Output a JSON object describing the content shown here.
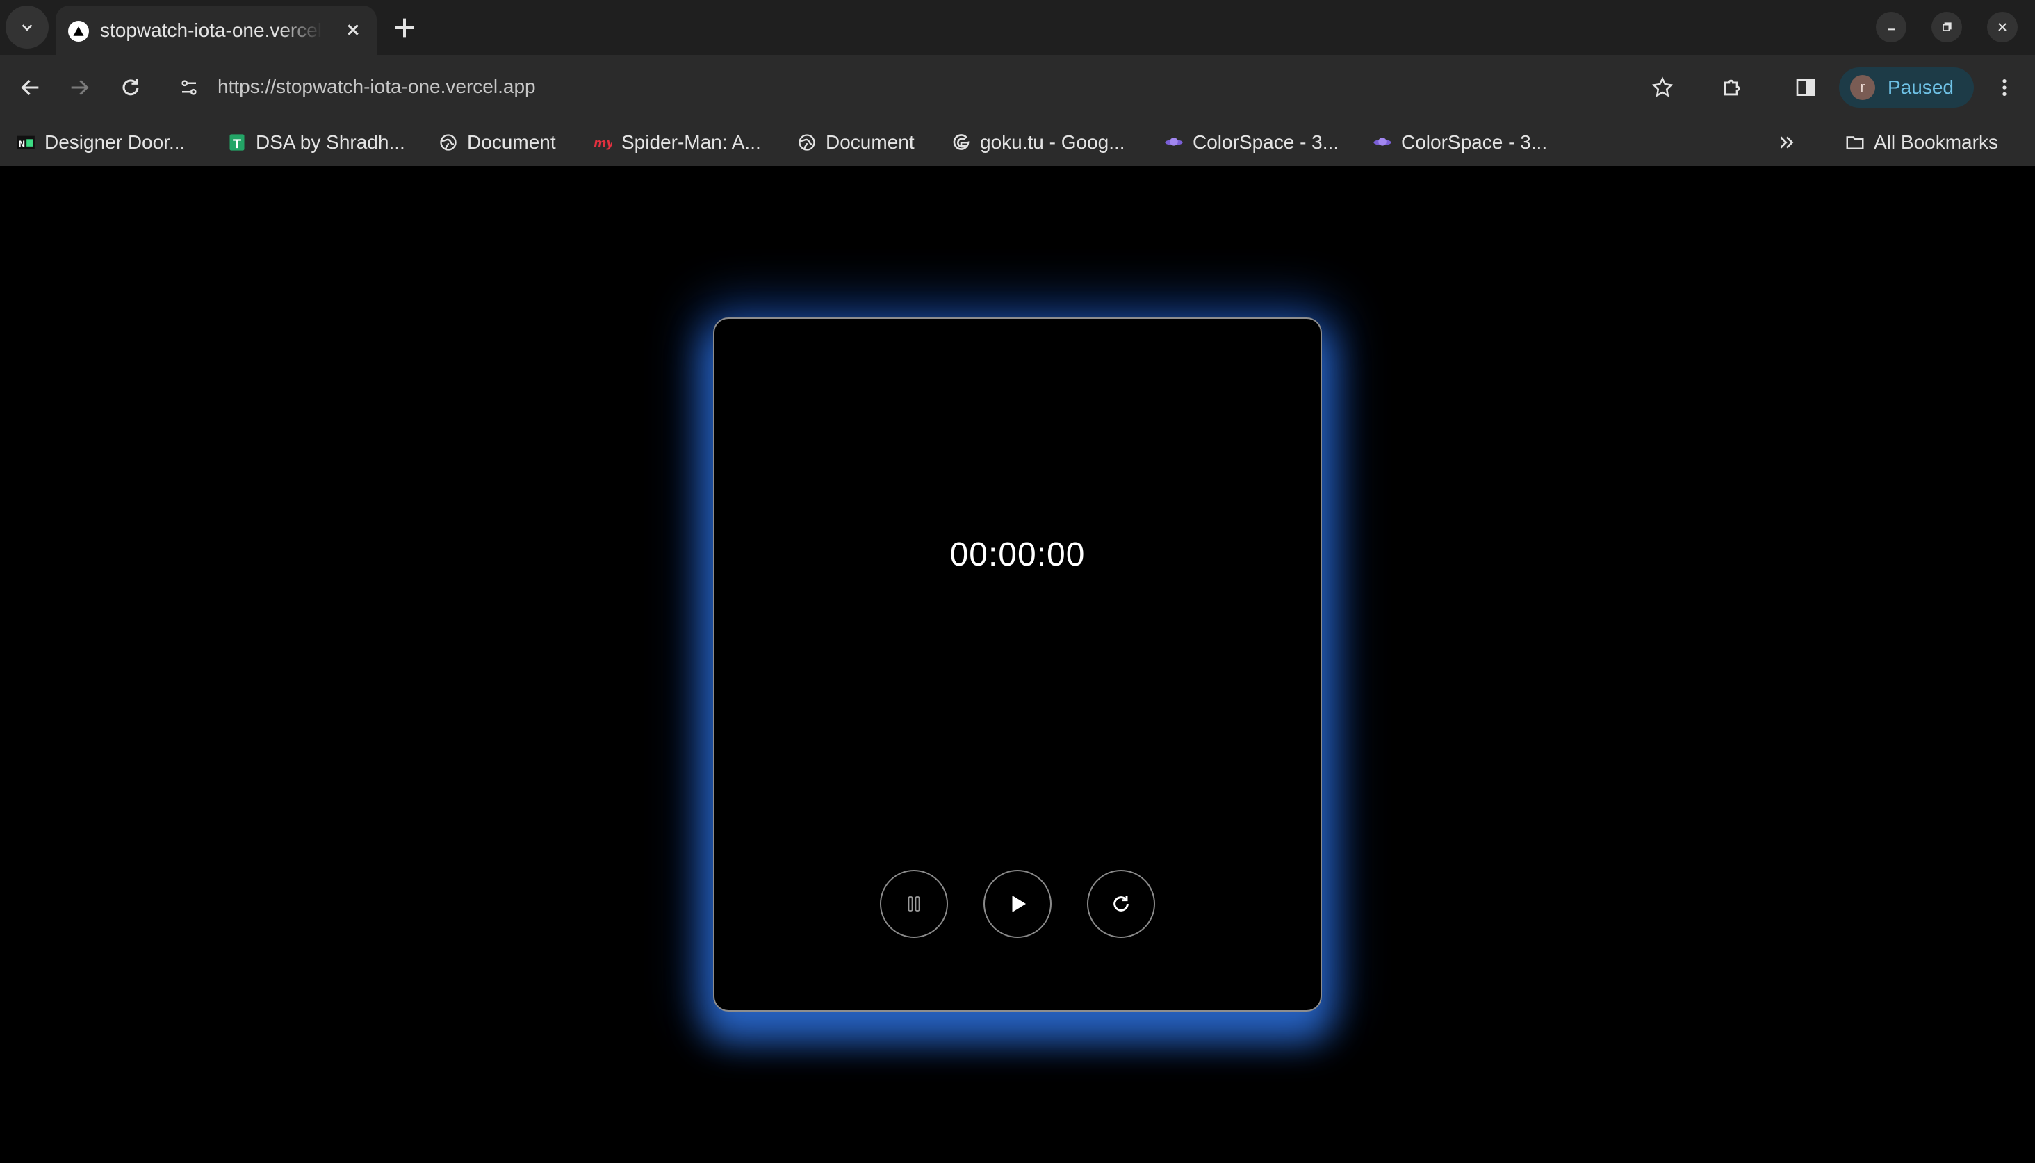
{
  "browser": {
    "tab": {
      "title": "stopwatch-iota-one.vercel.app"
    },
    "address_bar": {
      "url": "https://stopwatch-iota-one.vercel.app"
    },
    "profile": {
      "initial": "r",
      "status": "Paused"
    },
    "bookmarks": [
      {
        "label": "Designer Door...",
        "icon": "nb-favicon"
      },
      {
        "label": "DSA by Shradh...",
        "icon": "sheets-favicon"
      },
      {
        "label": "Document",
        "icon": "globe-icon"
      },
      {
        "label": "Spider-Man: A...",
        "icon": "my-favicon"
      },
      {
        "label": "Document",
        "icon": "globe-icon"
      },
      {
        "label": "goku.tu - Goog...",
        "icon": "google-favicon"
      },
      {
        "label": "ColorSpace - 3...",
        "icon": "colorspace-favicon"
      },
      {
        "label": "ColorSpace - 3...",
        "icon": "colorspace-favicon"
      }
    ],
    "all_bookmarks_label": "All Bookmarks"
  },
  "stopwatch": {
    "time": "00:00:00",
    "controls": [
      "pause",
      "play",
      "reset"
    ]
  },
  "colors": {
    "glow": "#2b6cd2",
    "page_background": "#000000",
    "profile_text": "#6fc2e6"
  }
}
